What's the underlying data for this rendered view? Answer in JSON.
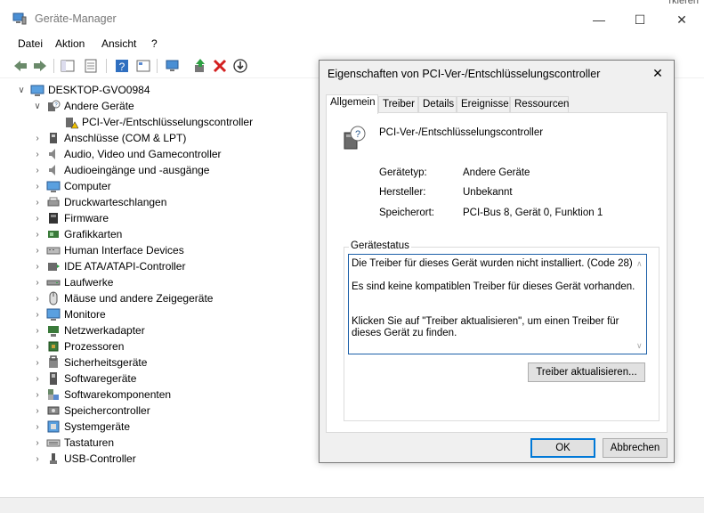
{
  "window": {
    "title": "Geräte-Manager",
    "corner_fragment": "rkieren"
  },
  "menu": [
    "Datei",
    "Aktion",
    "Ansicht",
    "?"
  ],
  "tree": {
    "root": "DESKTOP-GVO0984",
    "items": [
      {
        "label": "Andere Geräte",
        "icon": "other-devices-icon",
        "expanded": true
      },
      {
        "label": "PCI-Ver-/Entschlüsselungscontroller",
        "icon": "warning-device-icon",
        "child": true
      },
      {
        "label": "Anschlüsse (COM & LPT)",
        "icon": "port-icon"
      },
      {
        "label": "Audio, Video und Gamecontroller",
        "icon": "speaker-icon"
      },
      {
        "label": "Audioeingänge und -ausgänge",
        "icon": "speaker-icon"
      },
      {
        "label": "Computer",
        "icon": "computer-icon"
      },
      {
        "label": "Druckwarteschlangen",
        "icon": "printer-icon"
      },
      {
        "label": "Firmware",
        "icon": "firmware-icon"
      },
      {
        "label": "Grafikkarten",
        "icon": "display-adapter-icon"
      },
      {
        "label": "Human Interface Devices",
        "icon": "hid-icon"
      },
      {
        "label": "IDE ATA/ATAPI-Controller",
        "icon": "ide-icon"
      },
      {
        "label": "Laufwerke",
        "icon": "drive-icon"
      },
      {
        "label": "Mäuse und andere Zeigegeräte",
        "icon": "mouse-icon"
      },
      {
        "label": "Monitore",
        "icon": "monitor-icon"
      },
      {
        "label": "Netzwerkadapter",
        "icon": "network-icon"
      },
      {
        "label": "Prozessoren",
        "icon": "processor-icon"
      },
      {
        "label": "Sicherheitsgeräte",
        "icon": "security-icon"
      },
      {
        "label": "Softwaregeräte",
        "icon": "software-device-icon"
      },
      {
        "label": "Softwarekomponenten",
        "icon": "software-component-icon"
      },
      {
        "label": "Speichercontroller",
        "icon": "storage-icon"
      },
      {
        "label": "Systemgeräte",
        "icon": "system-icon"
      },
      {
        "label": "Tastaturen",
        "icon": "keyboard-icon"
      },
      {
        "label": "USB-Controller",
        "icon": "usb-icon"
      }
    ]
  },
  "dialog": {
    "title": "Eigenschaften von PCI-Ver-/Entschlüsselungscontroller",
    "close": "✕",
    "tabs": [
      "Allgemein",
      "Treiber",
      "Details",
      "Ereignisse",
      "Ressourcen"
    ],
    "device_name": "PCI-Ver-/Entschlüsselungscontroller",
    "props": [
      {
        "key": "Gerätetyp:",
        "value": "Andere Geräte"
      },
      {
        "key": "Hersteller:",
        "value": "Unbekannt"
      },
      {
        "key": "Speicherort:",
        "value": "PCI-Bus 8, Gerät 0, Funktion 1"
      }
    ],
    "status_group": "Gerätestatus",
    "status_lines": [
      "Die Treiber für dieses Gerät wurden nicht installiert. (Code 28)",
      "Es sind keine kompatiblen Treiber für dieses Gerät vorhanden.",
      "Klicken Sie auf \"Treiber aktualisieren\", um einen Treiber für dieses Gerät zu finden."
    ],
    "update_button": "Treiber aktualisieren...",
    "ok_button": "OK",
    "cancel_button": "Abbrechen"
  }
}
